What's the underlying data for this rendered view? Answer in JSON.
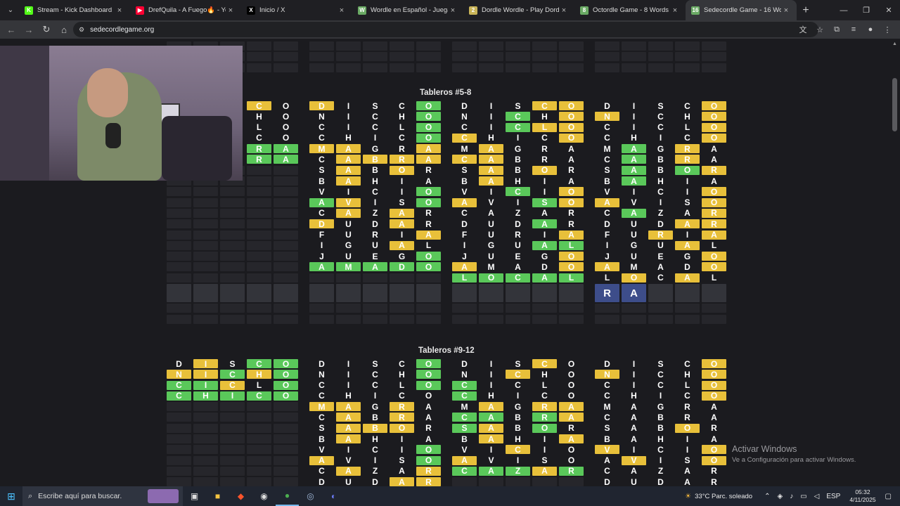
{
  "browser": {
    "tabs": [
      {
        "title": "Stream - Kick Dashboard",
        "favicon_color": "#53fc18",
        "favicon": "K"
      },
      {
        "title": "DrefQuila - A Fuego🔥 - Yo",
        "favicon_color": "#ff0033",
        "favicon": "▶"
      },
      {
        "title": "Inicio / X",
        "favicon_color": "#000000",
        "favicon": "X"
      },
      {
        "title": "Wordle en Español - Juega Wo",
        "favicon_color": "#6aaa64",
        "favicon": "W"
      },
      {
        "title": "Dordle Wordle - Play Dordle G",
        "favicon_color": "#c9b458",
        "favicon": "2"
      },
      {
        "title": "Octordle Game - 8 Words Won",
        "favicon_color": "#6aaa64",
        "favicon": "8"
      },
      {
        "title": "Sedecordle Game - 16 Words W",
        "favicon_color": "#6aaa64",
        "favicon": "16"
      }
    ],
    "url": "sedecordlegame.org"
  },
  "sections": {
    "tableros_5_8": "Tableros #5-8",
    "tableros_9_12": "Tableros #9-12"
  },
  "current_input": [
    "R",
    "A"
  ],
  "boards": {
    "row0": [
      {
        "rows": [
          "-----",
          "-----",
          "-----",
          "-----",
          "-----",
          "-----",
          "-----",
          "-----",
          "-----",
          "-----",
          "-----",
          "-----",
          "-----",
          "-----",
          "-----",
          "-----",
          "-----",
          "-----",
          "-----",
          "-----"
        ]
      },
      {
        "rows": []
      },
      {
        "rows": []
      },
      {
        "rows": []
      }
    ],
    "b4": {
      "rows": [
        [
          "?C",
          "y"
        ],
        [
          "?O",
          "n"
        ]
      ]
    }
  },
  "grid_5_8": [
    {
      "words": [
        "DISCO",
        "NICHO",
        "CICLO",
        "CHICO",
        "MAGRA",
        "CABRA",
        "SABOR",
        "BAHIA",
        "VICIO",
        "AVISO",
        "CAZAR",
        "DUDAR",
        "FURIA",
        "JUEGO",
        "AMADO"
      ],
      "colors": [
        "nnnyn",
        "nnngn",
        "nnngn",
        "nnnnn",
        "nnngg",
        "nnngg",
        "",
        "",
        "",
        "",
        "",
        "",
        "",
        "",
        ""
      ],
      "visible_from_col": 3,
      "rows_shown": 6
    },
    {
      "words": [
        "DISCO",
        "NICHO",
        "CICLO",
        "CHICO",
        "MAGRA",
        "CABRA",
        "SABOR",
        "BAHIA",
        "VICIO",
        "AVISO",
        "CAZAR",
        "DUDAR",
        "FURIA",
        "IGUAL",
        "JUEGO",
        "AMADO"
      ],
      "colors": [
        "ynnng",
        "nnnng",
        "nnnng",
        "nnnng",
        "yynny",
        "nyyyy",
        "nynyn",
        "nynnn",
        "nnnng",
        "gynng",
        "nynyn",
        "ynnyn",
        "nnnny",
        "nnnyn",
        "nnnng",
        "ggggg"
      ]
    },
    {
      "words": [
        "DISCO",
        "NICHO",
        "CICLO",
        "CHICO",
        "MAGRA",
        "CABRA",
        "SABOR",
        "BAHIA",
        "VICIO",
        "AVISO",
        "CAZAR",
        "DUDAR",
        "FURIA",
        "IGUAL",
        "JUEGO",
        "AMADO",
        "LOCAL"
      ],
      "colors": [
        "nnnyy",
        "nngny",
        "nngyy",
        "ynnny",
        "nynnn",
        "yynnn",
        "nynyn",
        "nynnn",
        "nngny",
        "ynngy",
        "nnnnn",
        "nnngn",
        "nnnny",
        "nnngg",
        "nnnny",
        "ynnny",
        "ggggg"
      ]
    },
    {
      "words": [
        "DISCO",
        "NICHO",
        "CICLO",
        "CHICO",
        "MAGRA",
        "CABRA",
        "SABOR",
        "BAHIA",
        "VICIO",
        "AVISO",
        "CAZAR",
        "DUDAR",
        "FURIA",
        "IGUAL",
        "JUEGO",
        "AMADO",
        "LOCAL"
      ],
      "colors": [
        "nnnny",
        "ynnny",
        "nnnny",
        "nnnny",
        "ngnyn",
        "ngnyn",
        "ngngy",
        "ngnnn",
        "nnnny",
        "ynnny",
        "ngnny",
        "nnnyy",
        "nnyny",
        "nnnyn",
        "nnnny",
        "ynnny",
        "nynyn"
      ]
    }
  ],
  "grid_9_12": [
    {
      "words": [
        "DISCO",
        "NICHO",
        "CICLO",
        "CHICO"
      ],
      "colors": [
        "nynggn",
        "yygyg",
        "ggyng",
        "ggggg"
      ]
    },
    {
      "words": [
        "DISCO",
        "NICHO",
        "CICLO",
        "CHICO",
        "MAGRA",
        "CABRA",
        "SABOR",
        "BAHIA",
        "VICIO",
        "AVISO",
        "CAZAR",
        "DUDAR"
      ],
      "colors": [
        "nnnng",
        "nnnng",
        "nnnng",
        "nnnnn",
        "yynyn",
        "nynyn",
        "nyyyn",
        "nynnn",
        "nnnng",
        "ynnng",
        "nynny",
        "nnnyy"
      ]
    },
    {
      "words": [
        "DISCO",
        "NICHO",
        "CICLO",
        "CHICO",
        "MAGRA",
        "CABRA",
        "SABOR",
        "BAHIA",
        "VICIO",
        "AVISO",
        "CAZAR"
      ],
      "colors": [
        "nnnyn",
        "nnynn",
        "gnnnn",
        "gnnnn",
        "nynyy",
        "ggngy",
        "gyngn",
        "nynny",
        "nnynn",
        "ynnnn",
        "gggyg"
      ]
    },
    {
      "words": [
        "DISCO",
        "NICHO",
        "CICLO",
        "CHICO",
        "MAGRA",
        "CABRA",
        "SABOR",
        "BAHIA",
        "VICIO",
        "AVISO",
        "CAZAR",
        "DUDAR"
      ],
      "colors": [
        "nnnny",
        "ynnny",
        "nnnny",
        "nnnny",
        "nnnnn",
        "nnnnn",
        "nnnyn",
        "nnnnn",
        "ynnny",
        "nynny",
        "nnnnn",
        "nnnnn"
      ]
    }
  ],
  "watermark": {
    "line1": "Activar Windows",
    "line2": "Ve a Configuración para activar Windows."
  },
  "taskbar": {
    "search_placeholder": "Escribe aquí para buscar.",
    "weather": "33°C  Parc. soleado",
    "lang": "ESP",
    "time": "05:32",
    "date": "4/11/2025"
  }
}
